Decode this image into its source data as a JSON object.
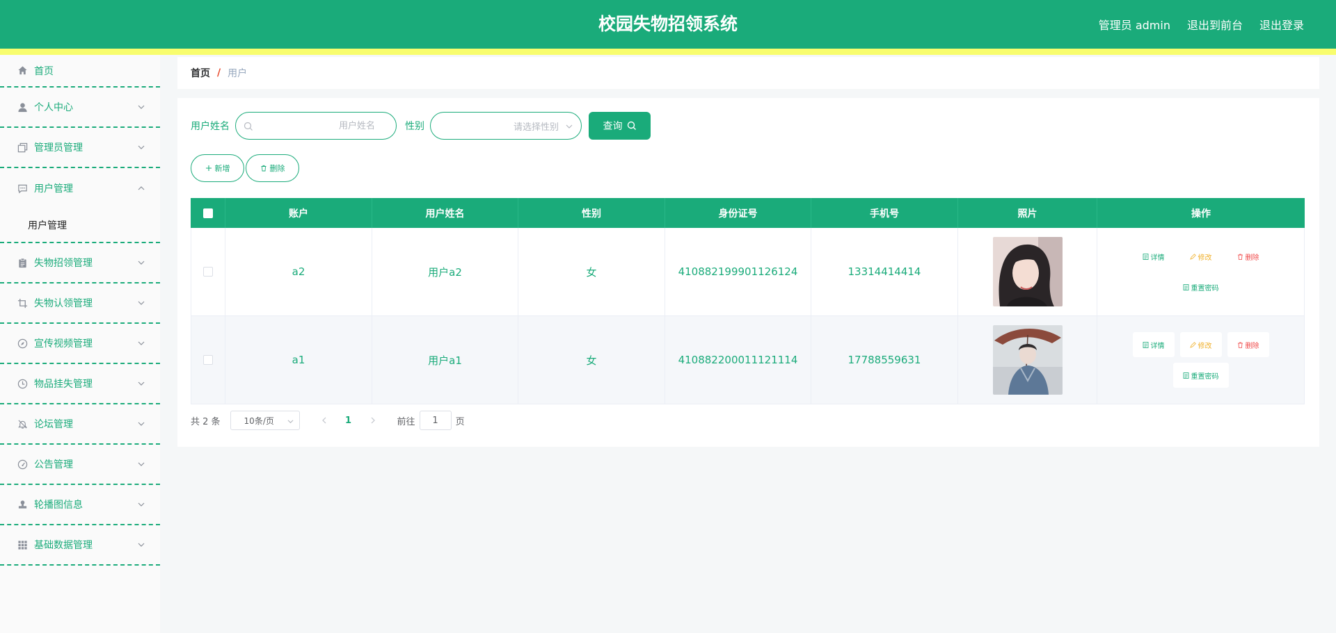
{
  "header": {
    "title": "校园失物招领系统",
    "user": "管理员 admin",
    "to_front": "退出到前台",
    "logout": "退出登录"
  },
  "sidebar": {
    "items": [
      {
        "label": "首页",
        "icon": "home-icon"
      },
      {
        "label": "个人中心",
        "icon": "user-icon"
      },
      {
        "label": "管理员管理",
        "icon": "copy-icon"
      },
      {
        "label": "用户管理",
        "icon": "chat-icon",
        "expanded": true,
        "children": [
          "用户管理"
        ]
      },
      {
        "label": "失物招领管理",
        "icon": "clipboard-icon"
      },
      {
        "label": "失物认领管理",
        "icon": "crop-icon"
      },
      {
        "label": "宣传视频管理",
        "icon": "compass-icon"
      },
      {
        "label": "物品挂失管理",
        "icon": "clock-icon"
      },
      {
        "label": "论坛管理",
        "icon": "bell-off-icon"
      },
      {
        "label": "公告管理",
        "icon": "gauge-icon"
      },
      {
        "label": "轮播图信息",
        "icon": "stamp-icon"
      },
      {
        "label": "基础数据管理",
        "icon": "grid-icon"
      }
    ]
  },
  "breadcrumb": {
    "home": "首页",
    "separator": "/",
    "current": "用户"
  },
  "search": {
    "name_label": "用户姓名",
    "name_placeholder": "用户姓名",
    "sex_label": "性别",
    "sex_placeholder": "请选择性别",
    "query_label": "查询"
  },
  "actions": {
    "add_label": "新增",
    "delete_label": "删除"
  },
  "table": {
    "columns": [
      "账户",
      "用户姓名",
      "性别",
      "身份证号",
      "手机号",
      "照片",
      "操作"
    ],
    "rows": [
      {
        "account": "a2",
        "name": "用户a2",
        "sex": "女",
        "id_card": "410882199901126124",
        "phone": "13314414414"
      },
      {
        "account": "a1",
        "name": "用户a1",
        "sex": "女",
        "id_card": "410882200011121114",
        "phone": "17788559631"
      }
    ],
    "ops": {
      "detail": "详情",
      "edit": "修改",
      "delete": "删除",
      "reset": "重置密码"
    }
  },
  "pagination": {
    "total": "共 2 条",
    "page_size": "10条/页",
    "current_page": "1",
    "goto_prefix": "前往",
    "goto_value": "1",
    "goto_suffix": "页"
  },
  "colors": {
    "primary": "#1aab7a",
    "accent_stripe": "#f8fd6e",
    "warning": "#f0b12e",
    "danger": "#f04848"
  }
}
